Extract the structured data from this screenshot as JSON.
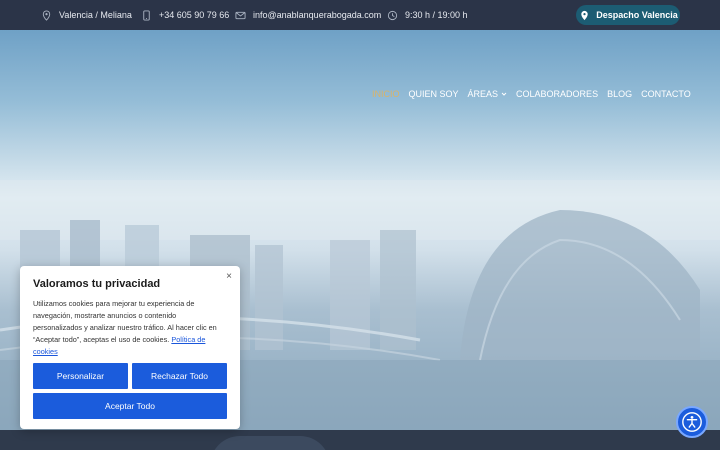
{
  "topbar": {
    "location": "Valencia / Meliana",
    "phone": "+34 605 90 79 66",
    "email": "info@anablanquerabogada.com",
    "hours": "9:30 h / 19:00 h",
    "cta_label": "Despacho Valencia",
    "icons": [
      "location-pin-icon",
      "phone-icon",
      "mail-icon",
      "clock-icon"
    ]
  },
  "nav": {
    "items": [
      {
        "label": "INICIO",
        "active": true
      },
      {
        "label": "QUIEN SOY"
      },
      {
        "label": "ÁREAS",
        "has_dropdown": true
      },
      {
        "label": "COLABORADORES"
      },
      {
        "label": "BLOG"
      },
      {
        "label": "CONTACTO"
      }
    ],
    "active_color": "#d9b46a"
  },
  "cookie": {
    "title": "Valoramos tu privacidad",
    "body": "Utilizamos cookies para mejorar tu experiencia de navegación, mostrarte anuncios o contenido personalizados y analizar nuestro tráfico. Al hacer clic en “Aceptar todo”, aceptas el uso de cookies.",
    "policy_link": "Política de cookies",
    "close_label": "×",
    "buttons": {
      "customize": "Personalizar",
      "reject": "Rechazar Todo",
      "accept": "Aceptar Todo"
    },
    "button_color": "#1b5cdc"
  },
  "accessibility": {
    "icon": "accessibility-icon"
  }
}
